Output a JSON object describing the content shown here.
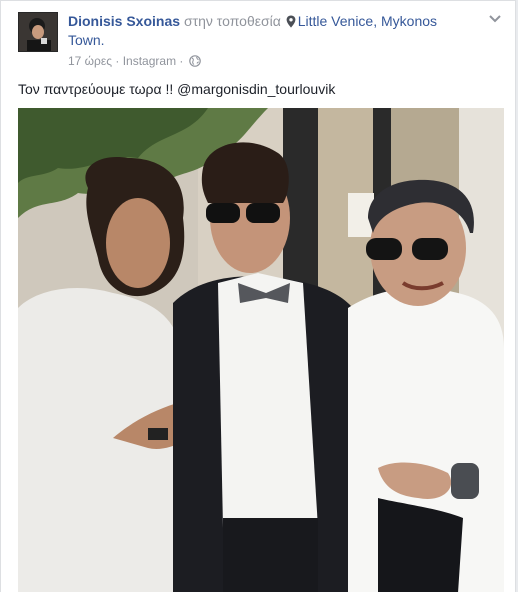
{
  "post": {
    "author": "Dionisis Sxoinas",
    "location_prefix": "στην τοποθεσία",
    "location": "Little Venice, Mykonos Town.",
    "time": "17 ώρες",
    "separator": "·",
    "source": "Instagram",
    "caption": "Τον παντρεύουμε τωρα !! @margonisdin_tourlouvik",
    "privacy_icon": "globe-icon",
    "options_icon": "chevron-down-icon"
  },
  "colors": {
    "link": "#365899",
    "secondary_text": "#90949c",
    "text": "#1d2129",
    "border": "#dddfe2"
  }
}
